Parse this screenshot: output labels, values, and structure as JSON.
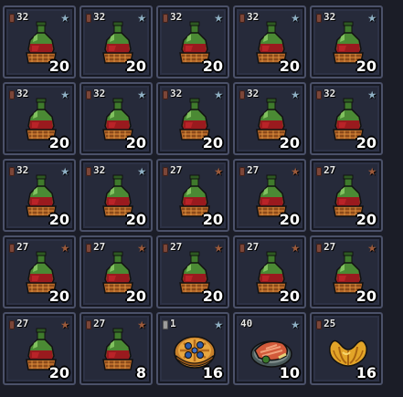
{
  "colors": {
    "star_silver": "#8fb0c4",
    "star_bronze": "#9c5a3a",
    "slot_border": "#4b5169",
    "slot_bg": "#262a3a"
  },
  "inventory": {
    "slots": [
      {
        "item": "bottle",
        "icon": "potion-bottle-icon",
        "badge": "32",
        "star": "silver",
        "qty": "20"
      },
      {
        "item": "bottle",
        "icon": "potion-bottle-icon",
        "badge": "32",
        "star": "silver",
        "qty": "20"
      },
      {
        "item": "bottle",
        "icon": "potion-bottle-icon",
        "badge": "32",
        "star": "silver",
        "qty": "20"
      },
      {
        "item": "bottle",
        "icon": "potion-bottle-icon",
        "badge": "32",
        "star": "silver",
        "qty": "20"
      },
      {
        "item": "bottle",
        "icon": "potion-bottle-icon",
        "badge": "32",
        "star": "silver",
        "qty": "20"
      },
      {
        "item": "bottle",
        "icon": "potion-bottle-icon",
        "badge": "32",
        "star": "silver",
        "qty": "20"
      },
      {
        "item": "bottle",
        "icon": "potion-bottle-icon",
        "badge": "32",
        "star": "silver",
        "qty": "20"
      },
      {
        "item": "bottle",
        "icon": "potion-bottle-icon",
        "badge": "32",
        "star": "silver",
        "qty": "20"
      },
      {
        "item": "bottle",
        "icon": "potion-bottle-icon",
        "badge": "32",
        "star": "silver",
        "qty": "20"
      },
      {
        "item": "bottle",
        "icon": "potion-bottle-icon",
        "badge": "32",
        "star": "silver",
        "qty": "20"
      },
      {
        "item": "bottle",
        "icon": "potion-bottle-icon",
        "badge": "32",
        "star": "silver",
        "qty": "20"
      },
      {
        "item": "bottle",
        "icon": "potion-bottle-icon",
        "badge": "32",
        "star": "silver",
        "qty": "20"
      },
      {
        "item": "bottle",
        "icon": "potion-bottle-icon",
        "badge": "27",
        "star": "bronze",
        "qty": "20"
      },
      {
        "item": "bottle",
        "icon": "potion-bottle-icon",
        "badge": "27",
        "star": "bronze",
        "qty": "20"
      },
      {
        "item": "bottle",
        "icon": "potion-bottle-icon",
        "badge": "27",
        "star": "bronze",
        "qty": "20"
      },
      {
        "item": "bottle",
        "icon": "potion-bottle-icon",
        "badge": "27",
        "star": "bronze",
        "qty": "20"
      },
      {
        "item": "bottle",
        "icon": "potion-bottle-icon",
        "badge": "27",
        "star": "bronze",
        "qty": "20"
      },
      {
        "item": "bottle",
        "icon": "potion-bottle-icon",
        "badge": "27",
        "star": "bronze",
        "qty": "20"
      },
      {
        "item": "bottle",
        "icon": "potion-bottle-icon",
        "badge": "27",
        "star": "bronze",
        "qty": "20"
      },
      {
        "item": "bottle",
        "icon": "potion-bottle-icon",
        "badge": "27",
        "star": "bronze",
        "qty": "20"
      },
      {
        "item": "bottle",
        "icon": "potion-bottle-icon",
        "badge": "27",
        "star": "bronze",
        "qty": "20"
      },
      {
        "item": "bottle",
        "icon": "potion-bottle-icon",
        "badge": "27",
        "star": "bronze",
        "qty": "8"
      },
      {
        "item": "pie",
        "icon": "blueberry-pie-icon",
        "badge": "1",
        "star": "silver",
        "badge_icon": "gray",
        "qty": "16"
      },
      {
        "item": "fish",
        "icon": "grilled-fish-plate-icon",
        "badge": "40",
        "star": "silver",
        "qty": "10",
        "no_badge_icon": true
      },
      {
        "item": "croissant",
        "icon": "croissant-icon",
        "badge": "25",
        "star": "none",
        "qty": "16"
      }
    ]
  }
}
